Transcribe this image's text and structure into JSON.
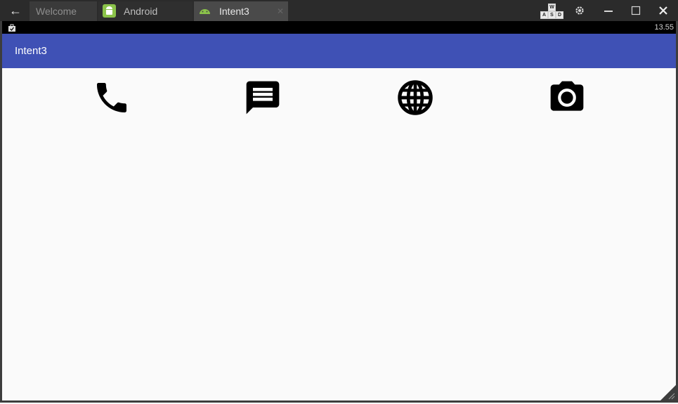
{
  "titlebar": {
    "tabs": [
      {
        "label": "Welcome"
      },
      {
        "label": "Android"
      },
      {
        "label": "Intent3",
        "active": true
      }
    ],
    "wasd_keys": [
      "W",
      "A",
      "S",
      "D"
    ]
  },
  "statusbar": {
    "clock": "13.55"
  },
  "appbar": {
    "title": "Intent3"
  },
  "actions": [
    {
      "icon": "phone-icon"
    },
    {
      "icon": "message-icon"
    },
    {
      "icon": "globe-icon"
    },
    {
      "icon": "camera-icon"
    }
  ],
  "colors": {
    "appbar": "#3f51b5",
    "content_bg": "#fafafa",
    "titlebar": "#2b2b2b"
  }
}
